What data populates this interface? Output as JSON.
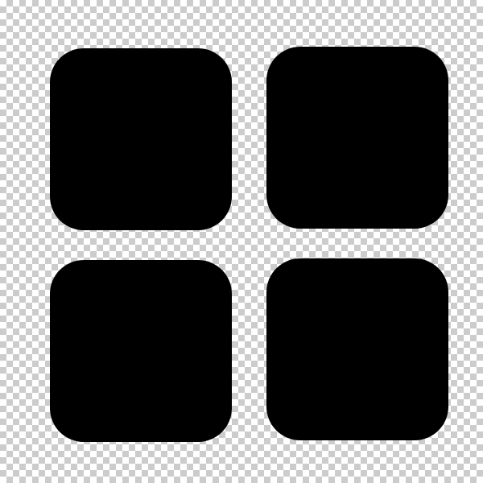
{
  "icon": {
    "name": "grid-icon",
    "tile_color": "#000000",
    "background": "transparent-checkerboard",
    "checker_colors": [
      "#ffffff",
      "#cccccc"
    ],
    "tiles": [
      "top-left",
      "top-right",
      "bottom-left",
      "bottom-right"
    ]
  }
}
